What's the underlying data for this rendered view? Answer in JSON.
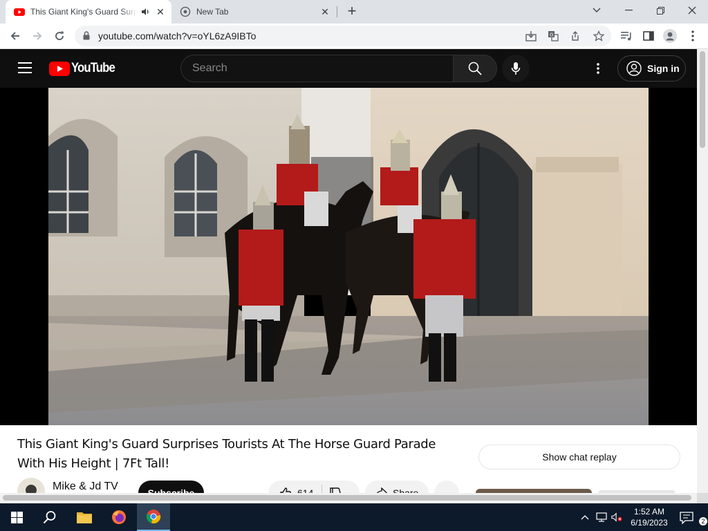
{
  "browser": {
    "tabs": [
      {
        "title": "This Giant King's Guard Surprises Tourists At The Horse Guard Parade",
        "active": true
      },
      {
        "title": "New Tab",
        "active": false
      }
    ],
    "url": "youtube.com/watch?v=oYL6zA9IBTo"
  },
  "youtube": {
    "logo_text": "YouTube",
    "search_placeholder": "Search",
    "signin_label": "Sign in",
    "video_title": "This Giant King's Guard Surprises Tourists At The Horse Guard Parade With His Height | 7Ft Tall!",
    "channel_name": "Mike & Jd TV",
    "subscribe_label": "Subscribe",
    "like_count": "614",
    "share_label": "Share",
    "chat_replay_label": "Show chat replay"
  },
  "taskbar": {
    "time": "1:52 AM",
    "date": "6/19/2023",
    "notification_count": "2"
  },
  "colors": {
    "youtube_red": "#ff0000",
    "guard_tunic_red": "#b31a1a",
    "taskbar": "#0c1a2b"
  }
}
